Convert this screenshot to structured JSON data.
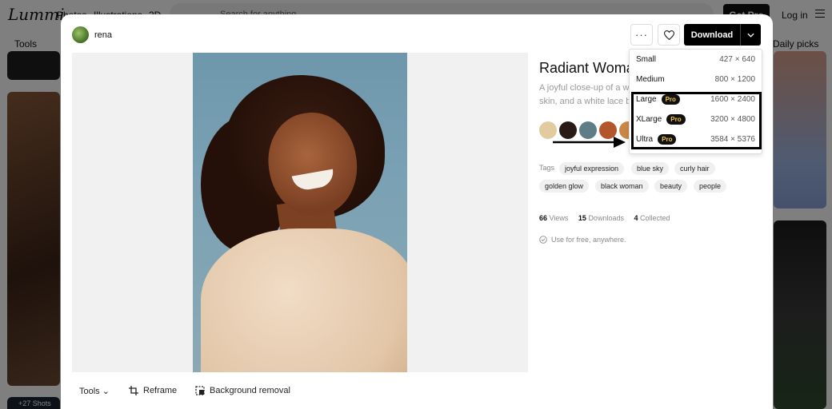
{
  "header": {
    "logo": "Lummi",
    "nav": [
      "Photos",
      "Illustrations",
      "3D"
    ],
    "search_placeholder": "Search for anything",
    "get_pro": "Get Pro",
    "login": "Log in"
  },
  "filters": {
    "tools": "Tools",
    "daily_picks": "Daily picks"
  },
  "background_tiles": {
    "shots_badge": "+27 Shots"
  },
  "modal": {
    "author": "rena",
    "more": "···",
    "download": "Download",
    "title": "Radiant Woman",
    "description_line1": "A joyful close-up of a w",
    "description_line2": "skin, and a white lace bl",
    "palette": [
      "#e3cba0",
      "#2a1a17",
      "#5f7d85",
      "#b4562c",
      "#c88745"
    ],
    "tags_label": "Tags",
    "tags": [
      "joyful expression",
      "blue sky",
      "curly hair",
      "golden glow",
      "black woman",
      "beauty",
      "people"
    ],
    "stats": {
      "views": "66",
      "views_label": "Views",
      "downloads": "15",
      "downloads_label": "Downloads",
      "collected": "4",
      "collected_label": "Collected"
    },
    "license": "Use for free, anywhere.",
    "toolbar": {
      "tools": "Tools",
      "reframe": "Reframe",
      "background_removal": "Background removal"
    },
    "download_options": [
      {
        "label": "Small",
        "size": "427 × 640",
        "pro": false
      },
      {
        "label": "Medium",
        "size": "800 × 1200",
        "pro": false
      },
      {
        "label": "Large",
        "size": "1600 × 2400",
        "pro": true
      },
      {
        "label": "XLarge",
        "size": "3200 × 4800",
        "pro": true
      },
      {
        "label": "Ultra",
        "size": "3584 × 5376",
        "pro": true
      }
    ],
    "pro_badge": "Pro"
  }
}
